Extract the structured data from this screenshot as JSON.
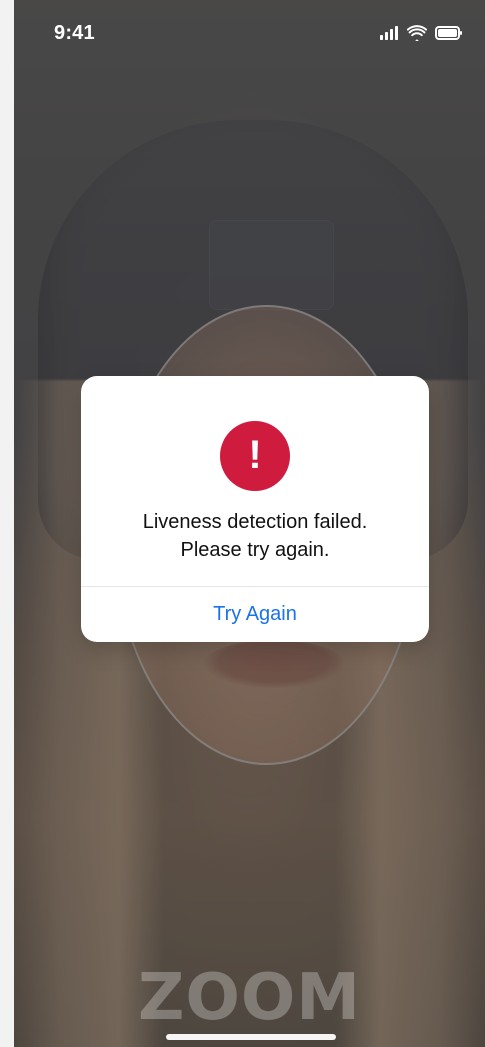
{
  "status_bar": {
    "time": "9:41",
    "icons": {
      "signal": "signal-bars-icon",
      "wifi": "wifi-icon",
      "battery": "battery-icon"
    }
  },
  "camera": {
    "brand": "ZOOM"
  },
  "dialog": {
    "alert_icon": "alert-circle-icon",
    "alert_glyph": "!",
    "message_line_1": "Liveness detection failed.",
    "message_line_2": "Please try again.",
    "action_label": "Try Again"
  },
  "colors": {
    "alert_red": "#cf1b3e",
    "action_blue": "#1a73e8"
  }
}
